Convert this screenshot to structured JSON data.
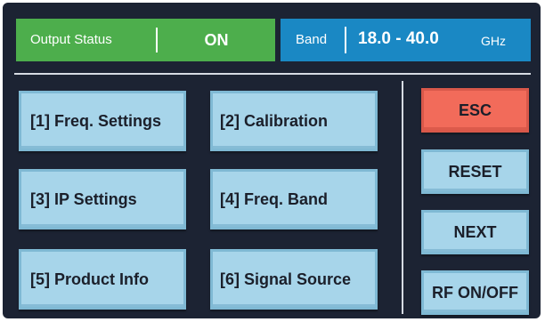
{
  "header": {
    "output_status_label": "Output Status",
    "output_status_value": "ON",
    "band_label": "Band",
    "band_range": "18.0 - 40.0",
    "band_unit": "GHz"
  },
  "menu": {
    "items": [
      {
        "label": "[1] Freq. Settings"
      },
      {
        "label": "[2] Calibration"
      },
      {
        "label": "[3] IP Settings"
      },
      {
        "label": "[4] Freq. Band"
      },
      {
        "label": "[5] Product Info"
      },
      {
        "label": "[6] Signal Source"
      }
    ]
  },
  "side": {
    "esc": "ESC",
    "reset": "RESET",
    "next": "NEXT",
    "rf": "RF ON/OFF"
  },
  "colors": {
    "background": "#1c2333",
    "status_on": "#4dae4c",
    "band_bar": "#1a88c4",
    "button": "#a7d5ea",
    "esc_button": "#f26b5a"
  }
}
